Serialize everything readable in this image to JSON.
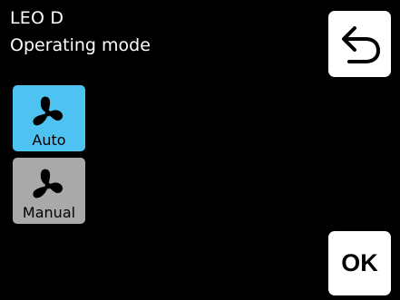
{
  "header": {
    "device_name": "LEO D",
    "screen_title": "Operating mode"
  },
  "buttons": {
    "back_icon": "back-arrow-icon",
    "ok_label": "OK"
  },
  "modes": [
    {
      "label": "Auto",
      "icon": "fan-icon",
      "selected": true,
      "color": "#4ec3f2"
    },
    {
      "label": "Manual",
      "icon": "fan-icon",
      "selected": false,
      "color": "#a9a9a9"
    }
  ]
}
